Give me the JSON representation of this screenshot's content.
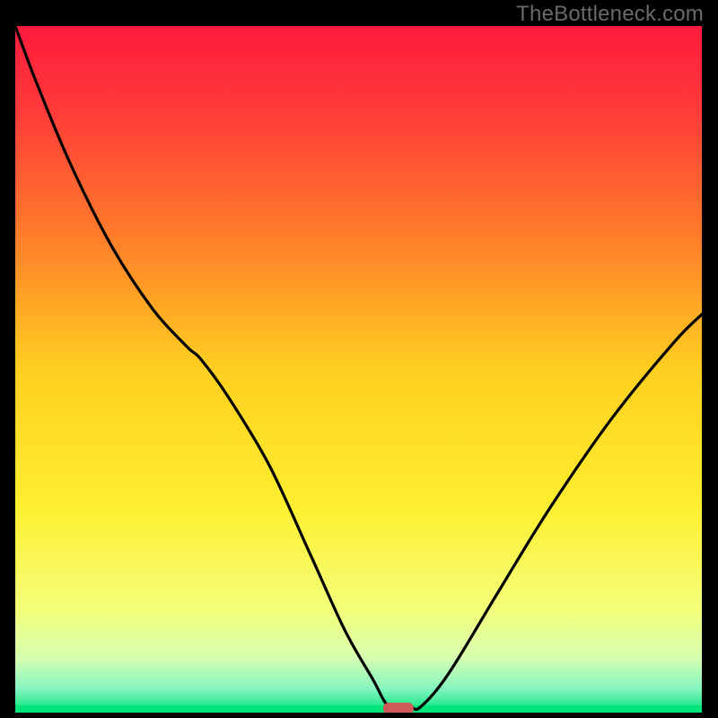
{
  "watermark": "TheBottleneck.com",
  "chart_data": {
    "type": "line",
    "title": "",
    "xlabel": "",
    "ylabel": "",
    "xrange": [
      0,
      1
    ],
    "yrange": [
      0,
      1
    ],
    "background_gradient": {
      "stops": [
        {
          "y": 0.0,
          "color": "#ff1a3d"
        },
        {
          "y": 0.12,
          "color": "#ff3a3a"
        },
        {
          "y": 0.3,
          "color": "#ff7a2a"
        },
        {
          "y": 0.5,
          "color": "#ffcf20"
        },
        {
          "y": 0.7,
          "color": "#ffef30"
        },
        {
          "y": 0.85,
          "color": "#f4ff7a"
        },
        {
          "y": 0.92,
          "color": "#d6ffb0"
        },
        {
          "y": 0.965,
          "color": "#86f5c0"
        },
        {
          "y": 1.0,
          "color": "#00e57a"
        }
      ]
    },
    "curve": {
      "description": "V-shaped bottleneck curve, minimum near x≈0.55, slightly flat at the trough",
      "x": [
        0.0,
        0.03,
        0.08,
        0.14,
        0.2,
        0.25,
        0.27,
        0.31,
        0.37,
        0.43,
        0.48,
        0.52,
        0.545,
        0.575,
        0.59,
        0.63,
        0.7,
        0.78,
        0.87,
        0.96,
        1.0
      ],
      "y": [
        1.0,
        0.92,
        0.8,
        0.68,
        0.588,
        0.533,
        0.515,
        0.46,
        0.36,
        0.23,
        0.12,
        0.05,
        0.008,
        0.008,
        0.008,
        0.055,
        0.17,
        0.3,
        0.43,
        0.54,
        0.58
      ]
    },
    "marker": {
      "description": "small rounded-rect marker at the trough",
      "x": 0.558,
      "y": 0.006,
      "color": "#ce5a5a"
    }
  }
}
